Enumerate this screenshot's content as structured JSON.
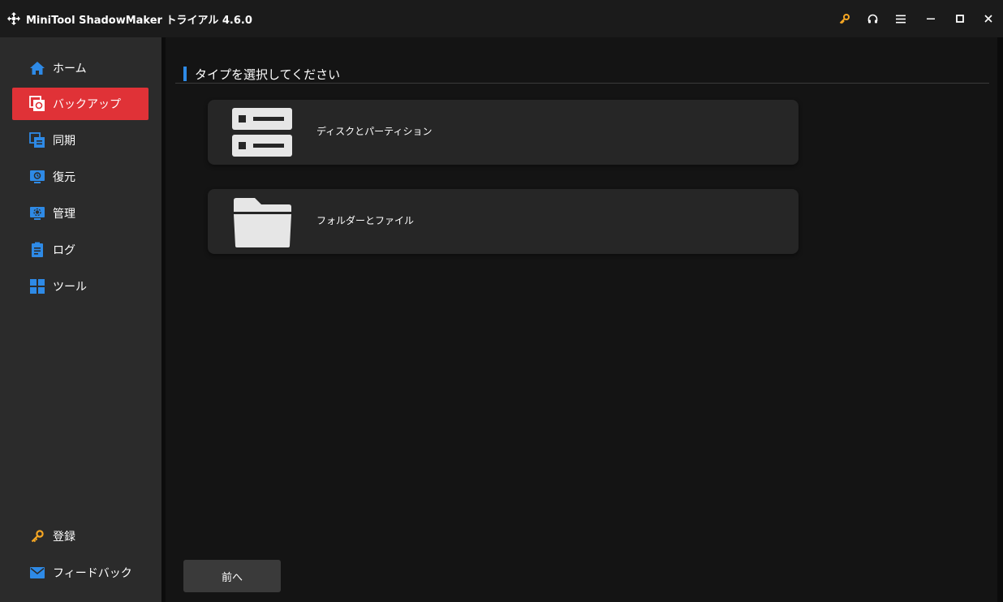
{
  "app": {
    "title": "MiniTool ShadowMaker トライアル 4.6.0"
  },
  "titlebar": {
    "buttons": [
      "key-icon",
      "headset-icon",
      "menu-icon",
      "minimize-icon",
      "maximize-icon",
      "close-icon"
    ]
  },
  "sidebar": {
    "items": [
      {
        "label": "ホーム",
        "icon": "home-icon",
        "active": false
      },
      {
        "label": "バックアップ",
        "icon": "backup-icon",
        "active": true
      },
      {
        "label": "同期",
        "icon": "sync-icon",
        "active": false
      },
      {
        "label": "復元",
        "icon": "restore-icon",
        "active": false
      },
      {
        "label": "管理",
        "icon": "manage-icon",
        "active": false
      },
      {
        "label": "ログ",
        "icon": "log-icon",
        "active": false
      },
      {
        "label": "ツール",
        "icon": "tools-icon",
        "active": false
      }
    ],
    "bottom": [
      {
        "label": "登録",
        "icon": "key-icon"
      },
      {
        "label": "フィードバック",
        "icon": "mail-icon"
      }
    ]
  },
  "main": {
    "section_title": "タイプを選択してください",
    "options": [
      {
        "label": "ディスクとパーティション",
        "icon": "disk-icon"
      },
      {
        "label": "フォルダーとファイル",
        "icon": "folder-icon"
      }
    ],
    "back_button": "前へ"
  },
  "colors": {
    "accent_red": "#e03237",
    "accent_blue": "#2e8ae6",
    "key_orange": "#f5a623"
  }
}
